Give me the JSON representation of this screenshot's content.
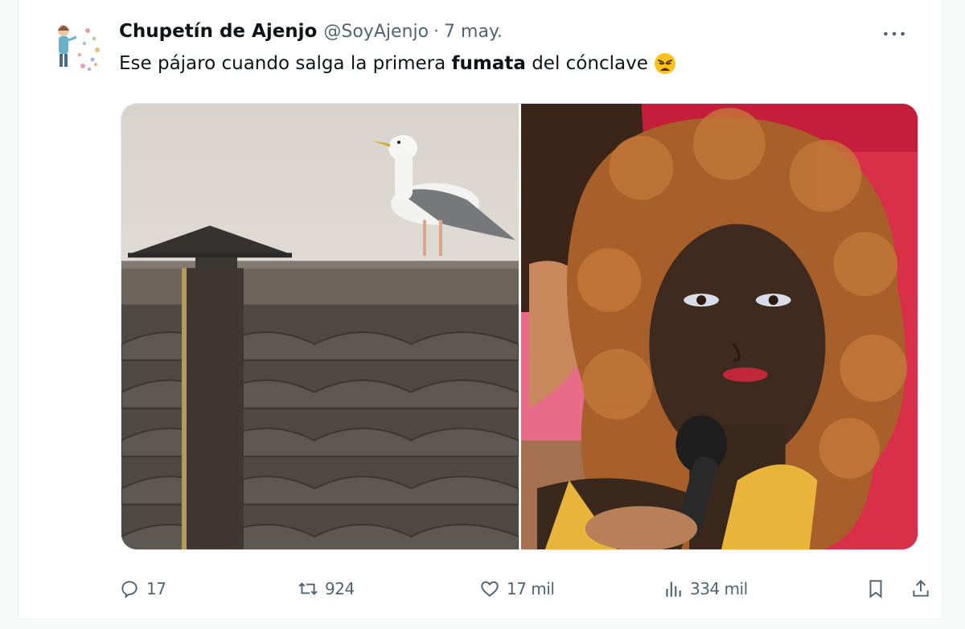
{
  "tweet": {
    "author_name": "Chupetín de Ajenjo",
    "author_handle": "@SoyAjenjo",
    "separator": "·",
    "date": "7 may.",
    "text_before": "Ese pájaro cuando salga la primera ",
    "text_bold": "fumata",
    "text_after": " del cónclave",
    "emoji": "weary-face-emoji"
  },
  "media": {
    "left_image": "seagull-on-roof-with-chimney",
    "right_image": "person-with-curly-wig-holding-microphone"
  },
  "actions": {
    "replies": "17",
    "reposts": "924",
    "likes": "17 mil",
    "views": "334 mil"
  },
  "icons": {
    "more": "more-icon",
    "reply": "reply-icon",
    "repost": "repost-icon",
    "like": "like-icon",
    "views": "views-icon",
    "bookmark": "bookmark-icon",
    "share": "share-icon"
  },
  "colors": {
    "text": "#0f1419",
    "secondary": "#536471",
    "background": "#ffffff"
  }
}
